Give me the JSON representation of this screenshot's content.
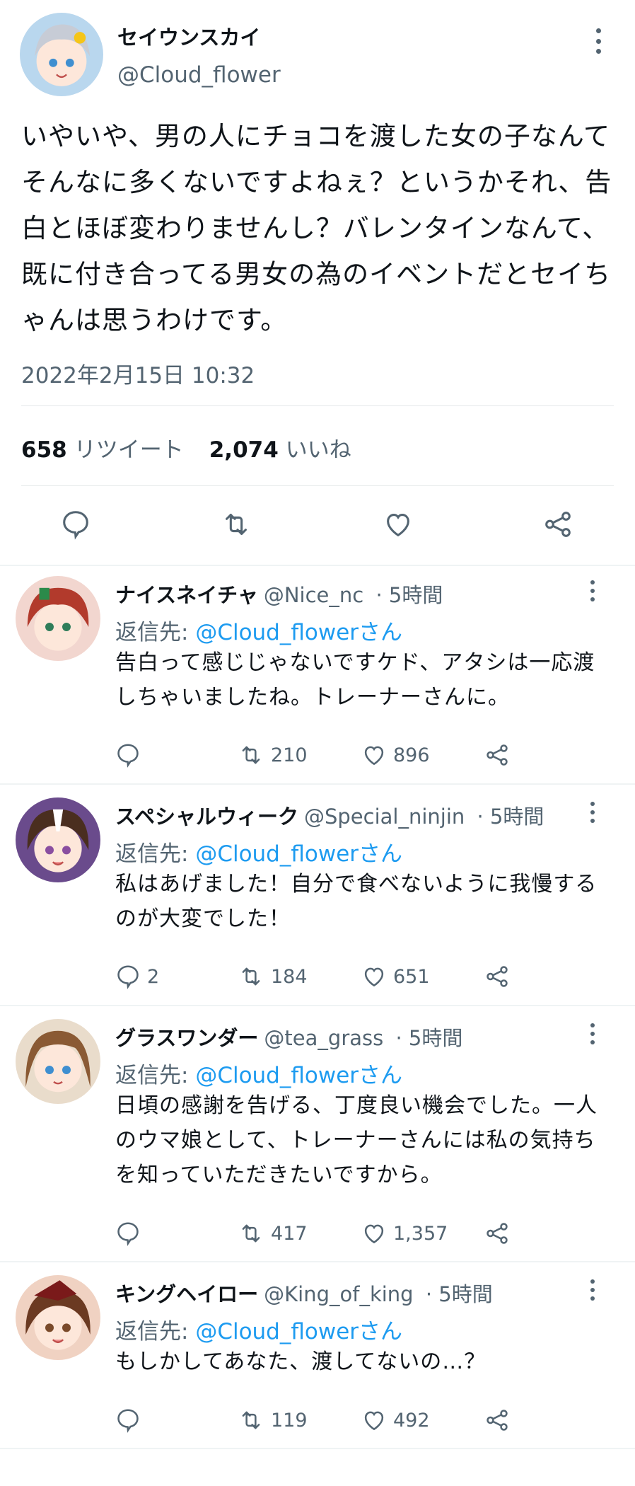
{
  "main_tweet": {
    "author_name": "セイウンスカイ",
    "author_handle": "@Cloud_flower",
    "text": "いやいや、男の人にチョコを渡した女の子なんてそんなに多くないですよねぇ？というかそれ、告白とほぼ変わりませんし？バレンタインなんて、既に付き合ってる男女の為のイベントだとセイちゃんは思うわけです。",
    "timestamp": "2022年2月15日 10:32",
    "retweet_count": "658",
    "retweet_label": "リツイート",
    "like_count": "2,074",
    "like_label": "いいね",
    "actions": [
      "reply-icon",
      "retweet-icon",
      "heart-icon",
      "share-icon"
    ]
  },
  "reply_prefix": "返信先:",
  "replies": [
    {
      "name": "ナイスネイチャ",
      "handle": "@Nice_nc",
      "time": "· 5時間",
      "reply_to": "@Cloud_flowerさん",
      "text": "告白って感じじゃないですケド、アタシは一応渡しちゃいましたね。トレーナーさんに。",
      "replies": "",
      "retweets": "210",
      "likes": "896"
    },
    {
      "name": "スペシャルウィーク",
      "handle": "@Special_ninjin",
      "time": "· 5時間",
      "reply_to": "@Cloud_flowerさん",
      "text": "私はあげました！自分で食べないように我慢するのが大変でした！",
      "replies": "2",
      "retweets": "184",
      "likes": "651"
    },
    {
      "name": "グラスワンダー",
      "handle": "@tea_grass",
      "time": "· 5時間",
      "reply_to": "@Cloud_flowerさん",
      "text": "日頃の感謝を告げる、丁度良い機会でした。一人のウマ娘として、トレーナーさんには私の気持ちを知っていただきたいですから。",
      "replies": "",
      "retweets": "417",
      "likes": "1,357"
    },
    {
      "name": "キングヘイロー",
      "handle": "@King_of_king",
      "time": "· 5時間",
      "reply_to": "@Cloud_flowerさん",
      "text": "もしかしてあなた、渡してないの…？",
      "replies": "",
      "retweets": "119",
      "likes": "492"
    }
  ],
  "colors": {
    "text": "#0f1419",
    "secondary": "#536471",
    "link": "#1d9bf0",
    "divider": "#eff3f4"
  }
}
